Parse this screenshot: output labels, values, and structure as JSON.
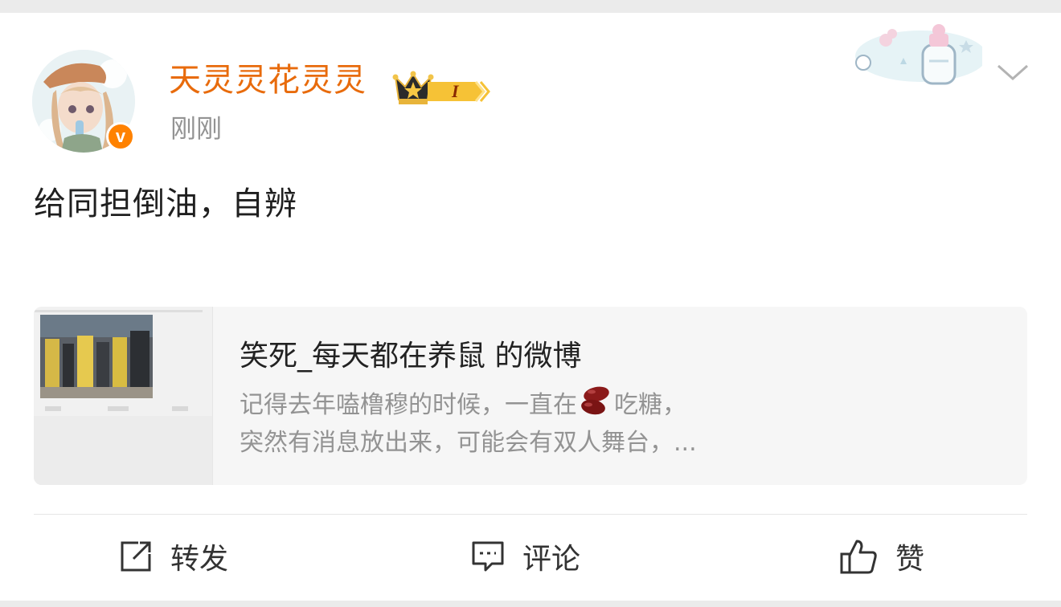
{
  "post": {
    "username": "天灵灵花灵灵",
    "level_badge": "I",
    "verified_badge": "v",
    "timestamp": "刚刚",
    "text": "给同担倒油，自辨"
  },
  "quote": {
    "title": "笑死_每天都在养鼠 的微博",
    "line1_before": "记得去年嗑橹穆的时候，一直在",
    "line1_emoji": "beans-emoji",
    "line1_after": "吃糖，",
    "line2": "突然有消息放出来，可能会有双人舞台，..."
  },
  "actions": {
    "repost_label": "转发",
    "comment_label": "评论",
    "like_label": "赞"
  },
  "icons": [
    "chevron-down-icon",
    "share-icon",
    "comment-icon",
    "thumbs-up-icon",
    "crown-icon"
  ],
  "colors": {
    "username": "#e86b0c",
    "verified": "#ff8200",
    "muted": "#939393",
    "text": "#1f1f1f"
  }
}
